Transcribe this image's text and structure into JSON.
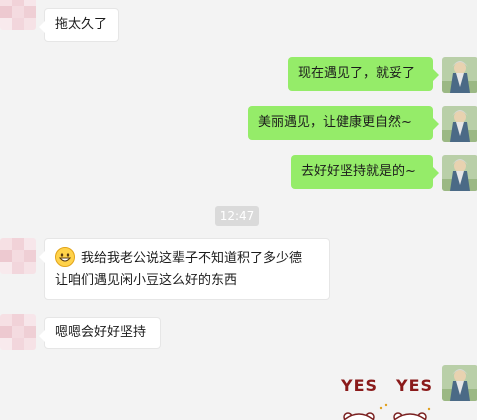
{
  "messages": [
    {
      "side": "left",
      "text": "拖太久了"
    },
    {
      "side": "right",
      "text": "现在遇见了，就妥了"
    },
    {
      "side": "right",
      "text": "美丽遇见，让健康更自然~"
    },
    {
      "side": "right",
      "text": "去好好坚持就是的~"
    },
    {
      "side": "left",
      "emoji": "grinning-face",
      "line1": "我给我老公说这辈子不知道积了多少德",
      "line2": "让咱们遇见闲小豆这么好的东西"
    },
    {
      "side": "left",
      "text": "嗯嗯会好好坚持"
    }
  ],
  "timestamp": "12:47",
  "sticker": {
    "text_left": "YES",
    "text_right": "YES"
  },
  "colors": {
    "background": "#f3f3f3",
    "bubble_sent": "#95ec69",
    "bubble_received": "#ffffff",
    "timestamp_bg": "#dadada",
    "sticker_text": "#8a1a1a"
  },
  "avatars": {
    "left": "pink-mosaic-avatar",
    "right": "sage-figure-avatar"
  }
}
